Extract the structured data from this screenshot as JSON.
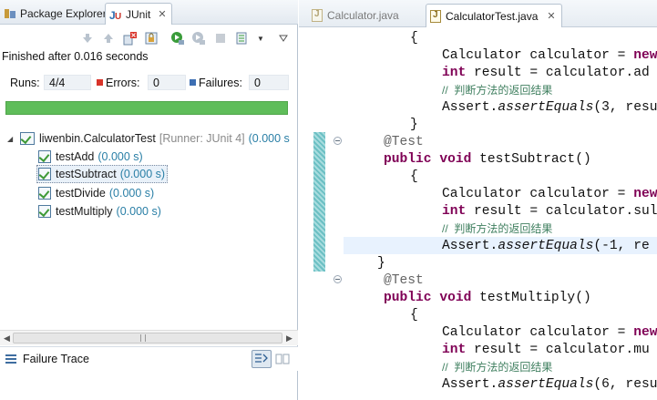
{
  "left_panel": {
    "tabs": {
      "package_explorer": "Package Explorer",
      "junit": "JUnit",
      "close": "✕"
    },
    "status": "Finished after 0.016 seconds",
    "counters": {
      "runs_label": "Runs:",
      "runs_value": "4/4",
      "errors_label": "Errors:",
      "errors_value": "0",
      "failures_label": "Failures:",
      "failures_value": "0"
    },
    "progress": {
      "fraction": 1.0,
      "color": "#5fbd5a"
    },
    "tree": {
      "root_label": "liwenbin.CalculatorTest",
      "root_runner": "[Runner: JUnit 4]",
      "root_time": "(0.000 s",
      "tests": [
        {
          "name": "testAdd",
          "time": "(0.000 s)"
        },
        {
          "name": "testSubtract",
          "time": "(0.000 s)"
        },
        {
          "name": "testDivide",
          "time": "(0.000 s)"
        },
        {
          "name": "testMultiply",
          "time": "(0.000 s)"
        }
      ]
    },
    "failure_trace_label": "Failure Trace"
  },
  "editor": {
    "tabs": [
      {
        "label": "Calculator.java"
      },
      {
        "label": "CalculatorTest.java",
        "close": "✕"
      }
    ],
    "code": {
      "brace_open": "{",
      "brace_close": "}",
      "decl": "Calculator calculator = ",
      "new_kw": "new",
      "int_kw": "int",
      "result_add": " result = calculator.ad",
      "result_sub": " result = calculator.sul",
      "result_mul": " result = calculator.mu",
      "comment": "//  判断方法的返回结果",
      "assert_prefix": "Assert.",
      "assert_method": "assertEquals",
      "assert_args_add": "(3, resu",
      "assert_args_sub": "(-1, re",
      "assert_args_mul": "(6, resu",
      "annotation": "@Test",
      "public_kw": "public",
      "void_kw": "void",
      "sig_sub": " testSubtract()",
      "sig_mul": " testMultiply()"
    }
  }
}
